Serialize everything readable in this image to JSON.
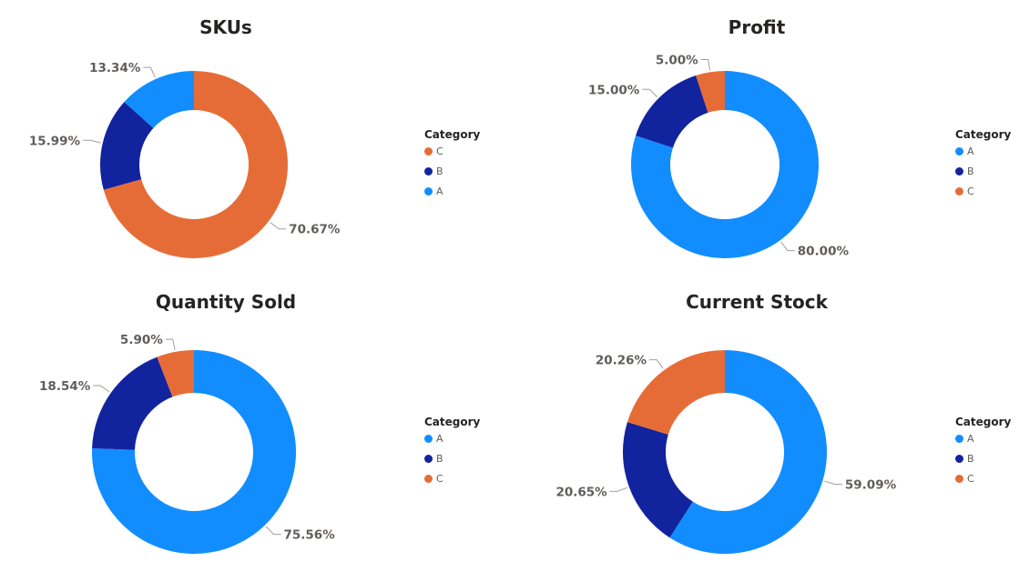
{
  "legend_title": "Category",
  "category_colors": {
    "A": "#118DFF",
    "B": "#12239E",
    "C": "#E66C37"
  },
  "chart_data": [
    {
      "type": "pie",
      "title": "SKUs",
      "legend": [
        "C",
        "B",
        "A"
      ],
      "slices": [
        {
          "category": "C",
          "value": 70.67,
          "label": "70.67%"
        },
        {
          "category": "B",
          "value": 15.99,
          "label": "15.99%"
        },
        {
          "category": "A",
          "value": 13.34,
          "label": "13.34%"
        }
      ]
    },
    {
      "type": "pie",
      "title": "Profit",
      "legend": [
        "A",
        "B",
        "C"
      ],
      "slices": [
        {
          "category": "A",
          "value": 80.0,
          "label": "80.00%"
        },
        {
          "category": "B",
          "value": 15.0,
          "label": "15.00%"
        },
        {
          "category": "C",
          "value": 5.0,
          "label": "5.00%"
        }
      ]
    },
    {
      "type": "pie",
      "title": "Quantity Sold",
      "legend": [
        "A",
        "B",
        "C"
      ],
      "slices": [
        {
          "category": "A",
          "value": 75.56,
          "label": "75.56%"
        },
        {
          "category": "B",
          "value": 18.54,
          "label": "18.54%"
        },
        {
          "category": "C",
          "value": 5.9,
          "label": "5.90%"
        }
      ]
    },
    {
      "type": "pie",
      "title": "Current Stock",
      "legend": [
        "A",
        "B",
        "C"
      ],
      "slices": [
        {
          "category": "A",
          "value": 59.09,
          "label": "59.09%"
        },
        {
          "category": "B",
          "value": 20.65,
          "label": "20.65%"
        },
        {
          "category": "C",
          "value": 20.26,
          "label": "20.26%"
        }
      ]
    }
  ]
}
